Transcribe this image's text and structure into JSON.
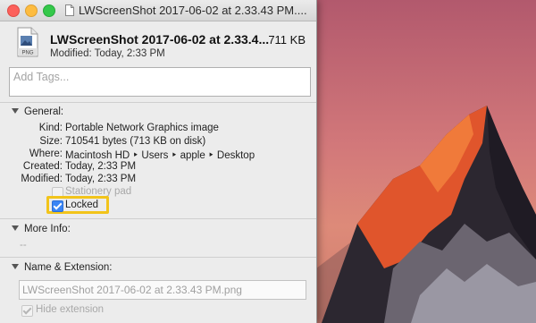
{
  "window": {
    "title": "LWScreenShot 2017-06-02 at 2.33.43 PM....",
    "traffic_lights": [
      "close",
      "minimize",
      "zoom"
    ]
  },
  "header": {
    "file_name": "LWScreenShot 2017-06-02 at 2.33.4...",
    "file_size": "711 KB",
    "modified": "Modified: Today, 2:33 PM",
    "icon_badge": "PNG"
  },
  "tags": {
    "placeholder": "Add Tags..."
  },
  "general": {
    "title": "General:",
    "rows": [
      {
        "key": "Kind:",
        "value": "Portable Network Graphics image"
      },
      {
        "key": "Size:",
        "value": "710541 bytes (713 KB on disk)"
      },
      {
        "key": "Where:",
        "value": "Macintosh HD ‣ Users ‣ apple ‣ Desktop"
      },
      {
        "key": "Created:",
        "value": "Today, 2:33 PM"
      },
      {
        "key": "Modified:",
        "value": "Today, 2:33 PM"
      }
    ],
    "stationery_label": "Stationery pad",
    "stationery_checked": false,
    "locked_label": "Locked",
    "locked_checked": true
  },
  "more_info": {
    "title": "More Info:",
    "value": "--"
  },
  "name_extension": {
    "title": "Name & Extension:",
    "field_value": "LWScreenShot 2017-06-02 at 2.33.43 PM.png",
    "hide_extension_label": "Hide extension",
    "hide_extension_checked": true
  },
  "colors": {
    "highlight": "#f2c41b",
    "checkbox_blue": "#3a85f5"
  }
}
